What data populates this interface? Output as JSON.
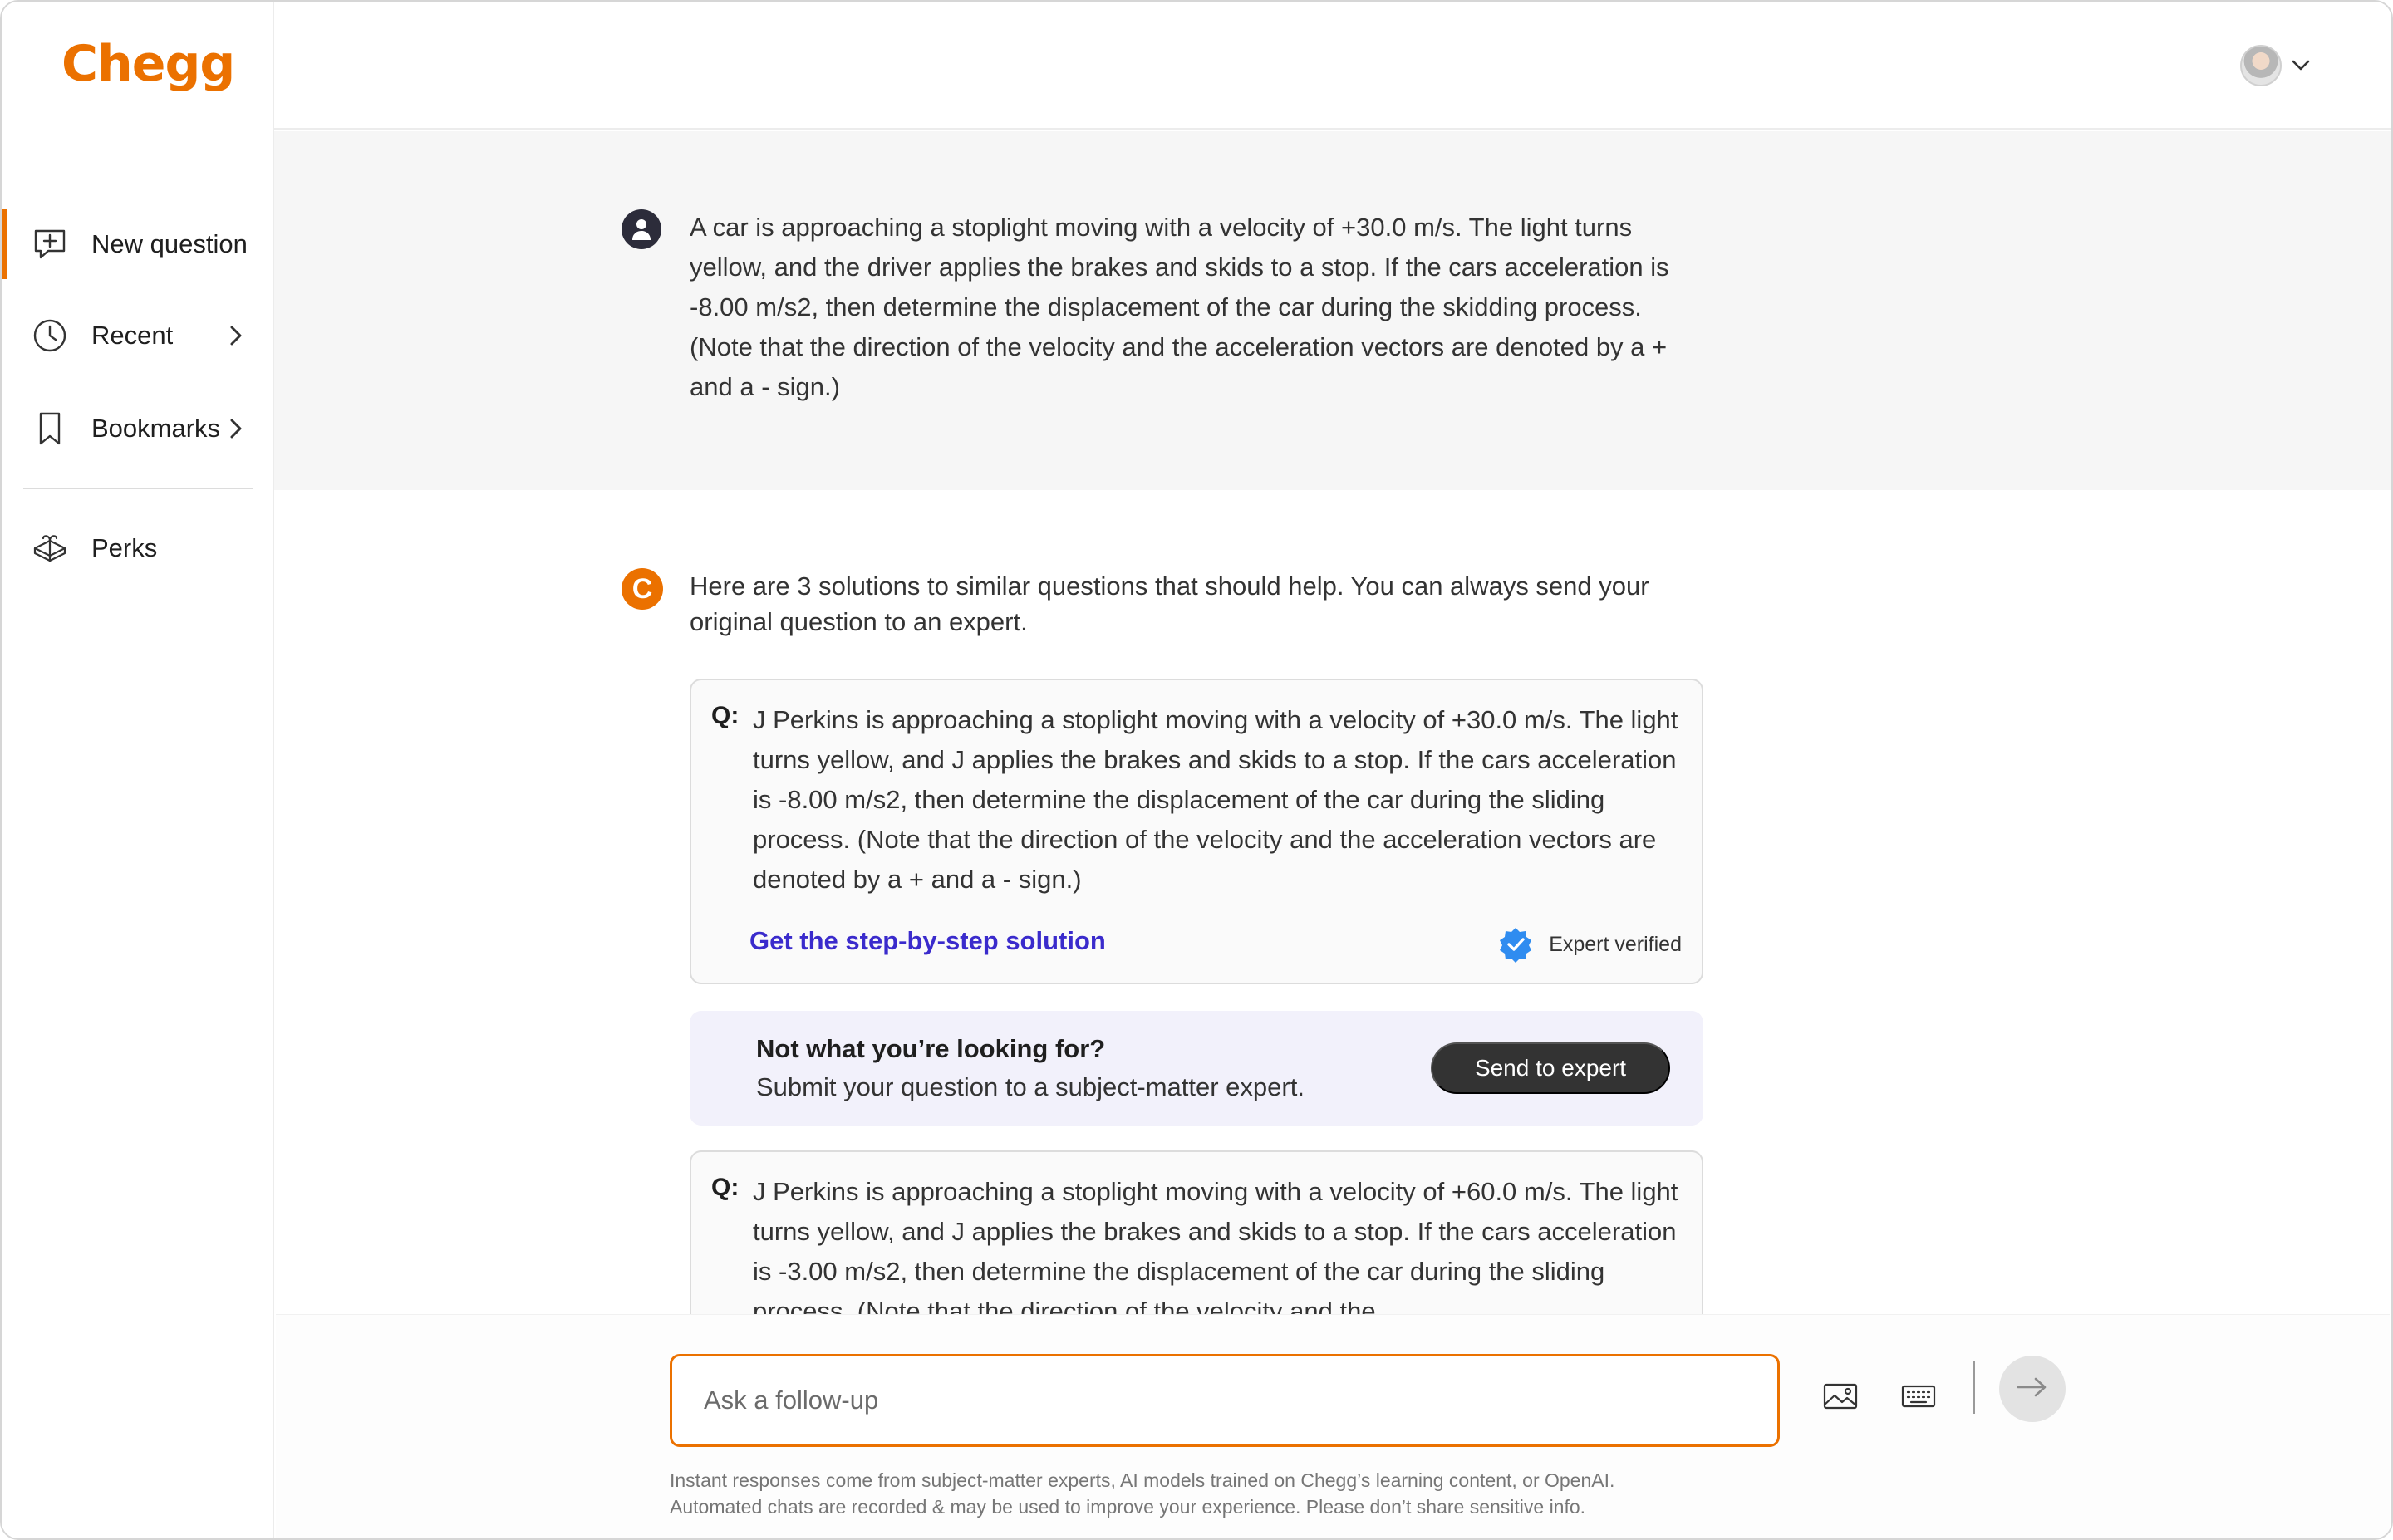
{
  "app": {
    "logo": "Chegg",
    "brand_color": "#eb7100"
  },
  "sidebar": {
    "items": [
      {
        "label": "New question",
        "icon": "chat-plus-icon",
        "active": true
      },
      {
        "label": "Recent",
        "icon": "clock-icon",
        "has_chevron": true
      },
      {
        "label": "Bookmarks",
        "icon": "bookmark-icon",
        "has_chevron": true
      },
      {
        "label": "Perks",
        "icon": "gift-icon"
      }
    ]
  },
  "header": {
    "avatar_icon": "user-avatar",
    "menu_icon": "chevron-down-icon"
  },
  "question": {
    "text": "A car is approaching a stoplight moving with a velocity of +30.0 m/s. The light turns yellow, and the driver applies the brakes and skids to a stop. If the cars acceleration is -8.00 m/s2, then determine the displacement of the car during the skidding process. (Note that the direction of the velocity and the acceleration vectors are denoted by a + and a - sign.)"
  },
  "answer": {
    "intro": "Here are 3 solutions to similar questions that should help. You can always send your original question to an expert.",
    "results": [
      {
        "q_label": "Q:",
        "text": "J Perkins is approaching a stoplight moving with a velocity of +30.0 m/s. The light turns yellow, and J applies the brakes and skids to a stop. If the cars acceleration is -8.00 m/s2, then determine the displacement of the car during the sliding process. (Note that the direction of the velocity and the acceleration vectors are denoted by a + and a - sign.)",
        "link": "Get the step-by-step solution",
        "badge": "Expert verified"
      },
      {
        "q_label": "Q:",
        "text": "J Perkins is approaching a stoplight moving with a velocity of +60.0 m/s. The light turns yellow, and J applies the brakes and skids to a stop. If the cars acceleration is -3.00 m/s2, then determine the displacement of the car during the sliding process. (Note that the direction of the velocity and the"
      }
    ],
    "not_found": {
      "title": "Not what you’re looking for?",
      "subtitle": "Submit your question to a subject-matter expert.",
      "button": "Send to expert"
    }
  },
  "composer": {
    "placeholder": "Ask a follow-up",
    "disclaimer_line1": "Instant responses come from subject-matter experts, AI models trained on Chegg’s learning content, or OpenAI.",
    "disclaimer_line2": "Automated chats are recorded & may be used to improve your experience. Please don’t share sensitive info."
  }
}
